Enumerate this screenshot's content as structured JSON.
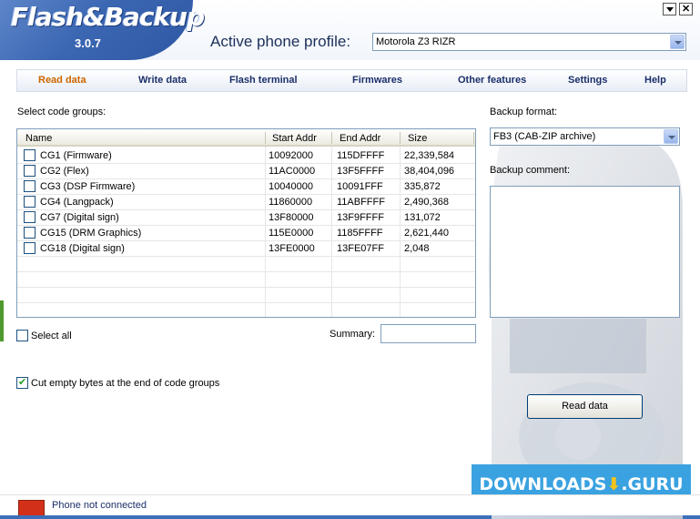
{
  "app": {
    "logo_text": "Flash&Backup",
    "version": "3.0.7",
    "profile_label": "Active phone profile:",
    "profile_value": "Motorola Z3 RIZR"
  },
  "nav": {
    "items": [
      {
        "label": "Read data",
        "active": true
      },
      {
        "label": "Write data",
        "active": false
      },
      {
        "label": "Flash terminal",
        "active": false
      },
      {
        "label": "Firmwares",
        "active": false
      },
      {
        "label": "Other features",
        "active": false
      },
      {
        "label": "Settings",
        "active": false
      },
      {
        "label": "Help",
        "active": false
      }
    ]
  },
  "code_groups": {
    "label": "Select code groups:",
    "columns": [
      "Name",
      "Start Addr",
      "End Addr",
      "Size"
    ],
    "rows": [
      {
        "name": "CG1 (Firmware)",
        "start": "10092000",
        "end": "115DFFFF",
        "size": "22,339,584",
        "checked": false
      },
      {
        "name": "CG2 (Flex)",
        "start": "11AC0000",
        "end": "13F5FFFF",
        "size": "38,404,096",
        "checked": false
      },
      {
        "name": "CG3 (DSP Firmware)",
        "start": "10040000",
        "end": "10091FFF",
        "size": "335,872",
        "checked": false
      },
      {
        "name": "CG4 (Langpack)",
        "start": "11860000",
        "end": "11ABFFFF",
        "size": "2,490,368",
        "checked": false
      },
      {
        "name": "CG7 (Digital sign)",
        "start": "13F80000",
        "end": "13F9FFFF",
        "size": "131,072",
        "checked": false
      },
      {
        "name": "CG15 (DRM Graphics)",
        "start": "115E0000",
        "end": "1185FFFF",
        "size": "2,621,440",
        "checked": false
      },
      {
        "name": "CG18 (Digital sign)",
        "start": "13FE0000",
        "end": "13FE07FF",
        "size": "2,048",
        "checked": false
      }
    ],
    "select_all_label": "Select all",
    "select_all_checked": false,
    "summary_label": "Summary:",
    "summary_value": "",
    "cut_bytes_label": "Cut empty bytes at the end of code groups",
    "cut_bytes_checked": true
  },
  "backup": {
    "format_label": "Backup format:",
    "format_value": "FB3 (CAB-ZIP archive)",
    "comment_label": "Backup comment:",
    "comment_value": "",
    "read_button": "Read data"
  },
  "status": {
    "text": "Phone not connected",
    "led_color": "#d3301a"
  },
  "watermark": {
    "text_left": "DOWNLOADS",
    "text_right": ".GURU"
  },
  "colors": {
    "active_nav": "#cc6600",
    "nav_text": "#1b2f6a",
    "header_blue": "#3b66b2"
  }
}
